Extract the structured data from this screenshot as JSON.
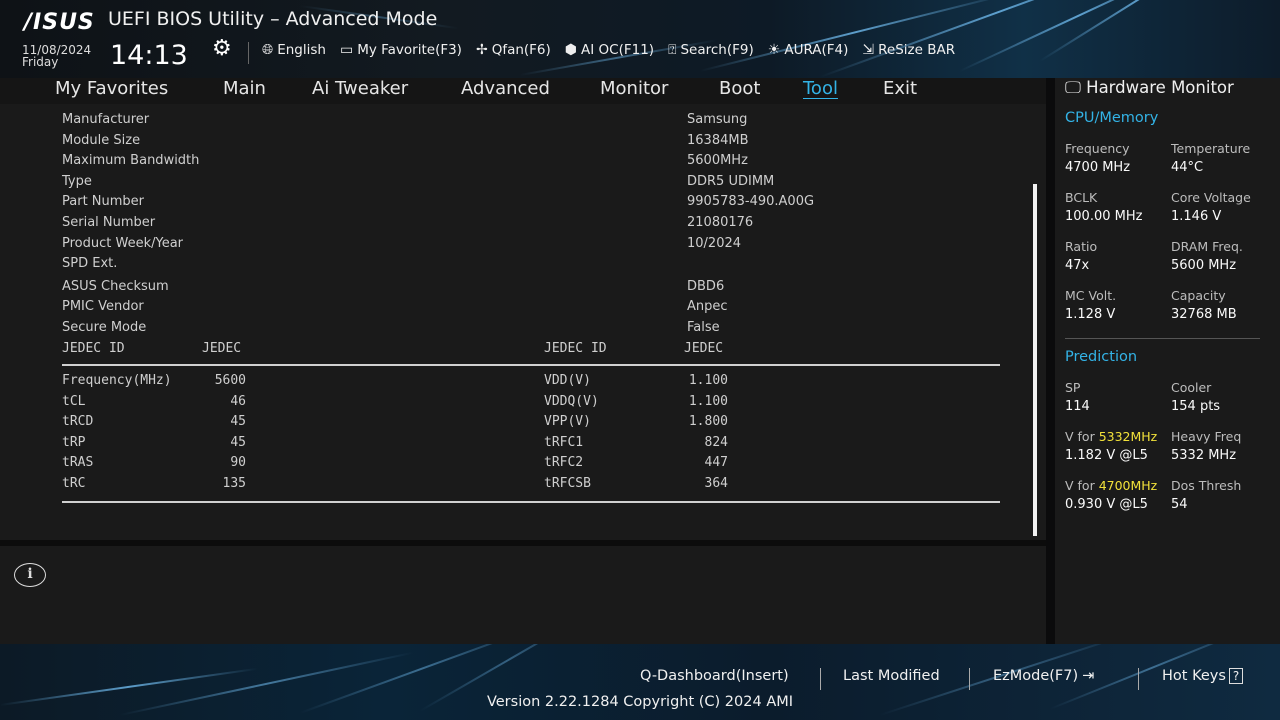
{
  "header": {
    "logo": "/ISUS",
    "title": "UEFI BIOS Utility – Advanced Mode",
    "date": "11/08/2024",
    "day": "Friday",
    "time": "14:13",
    "toolbar": [
      {
        "icon": "globe-icon",
        "label": "English"
      },
      {
        "icon": "favorite-icon",
        "label": "My Favorite(F3)"
      },
      {
        "icon": "fan-icon",
        "label": "Qfan(F6)"
      },
      {
        "icon": "ai-oc-icon",
        "label": "AI OC(F11)"
      },
      {
        "icon": "search-icon",
        "label": "Search(F9)"
      },
      {
        "icon": "aura-icon",
        "label": "AURA(F4)"
      },
      {
        "icon": "resize-bar-icon",
        "label": "ReSize BAR"
      }
    ]
  },
  "nav": {
    "tabs": [
      "My Favorites",
      "Main",
      "Ai Tweaker",
      "Advanced",
      "Monitor",
      "Boot",
      "Tool",
      "Exit"
    ],
    "active": "Tool"
  },
  "spd": {
    "items": [
      {
        "label": "Manufacturer",
        "value": "Samsung"
      },
      {
        "label": "Module Size",
        "value": "16384MB"
      },
      {
        "label": "Maximum Bandwidth",
        "value": "5600MHz"
      },
      {
        "label": "Type",
        "value": "DDR5 UDIMM"
      },
      {
        "label": "Part Number",
        "value": "9905783-490.A00G"
      },
      {
        "label": "Serial Number",
        "value": "21080176"
      },
      {
        "label": "Product Week/Year",
        "value": "10/2024"
      },
      {
        "label": "SPD Ext.",
        "value": ""
      },
      {
        "label": "ASUS Checksum",
        "value": "DBD6"
      },
      {
        "label": "PMIC Vendor",
        "value": "Anpec"
      },
      {
        "label": "Secure Mode",
        "value": "False"
      }
    ],
    "table_header": {
      "left_label": "JEDEC ID",
      "left_value": "JEDEC",
      "right_label": "JEDEC ID",
      "right_value": "JEDEC"
    },
    "timings": [
      {
        "l": "Frequency(MHz)",
        "lv": "5600",
        "r": "VDD(V)",
        "rv": "1.100"
      },
      {
        "l": "tCL",
        "lv": "46",
        "r": "VDDQ(V)",
        "rv": "1.100"
      },
      {
        "l": "tRCD",
        "lv": "45",
        "r": "VPP(V)",
        "rv": "1.800"
      },
      {
        "l": "tRP",
        "lv": "45",
        "r": "tRFC1",
        "rv": "824"
      },
      {
        "l": "tRAS",
        "lv": "90",
        "r": "tRFC2",
        "rv": "447"
      },
      {
        "l": "tRC",
        "lv": "135",
        "r": "tRFCSB",
        "rv": "364"
      }
    ]
  },
  "hw": {
    "title": "Hardware Monitor",
    "cpu_section": "CPU/Memory",
    "cpu": [
      {
        "label": "Frequency",
        "value": "4700 MHz"
      },
      {
        "label": "Temperature",
        "value": "44°C"
      },
      {
        "label": "BCLK",
        "value": "100.00 MHz"
      },
      {
        "label": "Core Voltage",
        "value": "1.146 V"
      },
      {
        "label": "Ratio",
        "value": "47x"
      },
      {
        "label": "DRAM Freq.",
        "value": "5600 MHz"
      },
      {
        "label": "MC Volt.",
        "value": "1.128 V"
      },
      {
        "label": "Capacity",
        "value": "32768 MB"
      }
    ],
    "pred_section": "Prediction",
    "pred": {
      "sp_label": "SP",
      "sp_value": "114",
      "cooler_label": "Cooler",
      "cooler_value": "154 pts",
      "v1_prefix": "V for ",
      "v1_freq": "5332MHz",
      "v1_value": "1.182 V @L5",
      "heavy_label": "Heavy Freq",
      "heavy_value": "5332 MHz",
      "v2_prefix": "V for ",
      "v2_freq": "4700MHz",
      "v2_value": "0.930 V @L5",
      "dos_label": "Dos Thresh",
      "dos_value": "54"
    }
  },
  "footer": {
    "qdash": "Q-Dashboard(Insert)",
    "last_modified": "Last Modified",
    "ezmode": "EzMode(F7)",
    "hotkeys": "Hot Keys",
    "hotkeys_box": "?",
    "version": "Version 2.22.1284 Copyright (C) 2024 AMI"
  },
  "colors": {
    "accent": "#33b3e6",
    "highlight": "#f2e13a",
    "panel": "#1a1a1a"
  }
}
